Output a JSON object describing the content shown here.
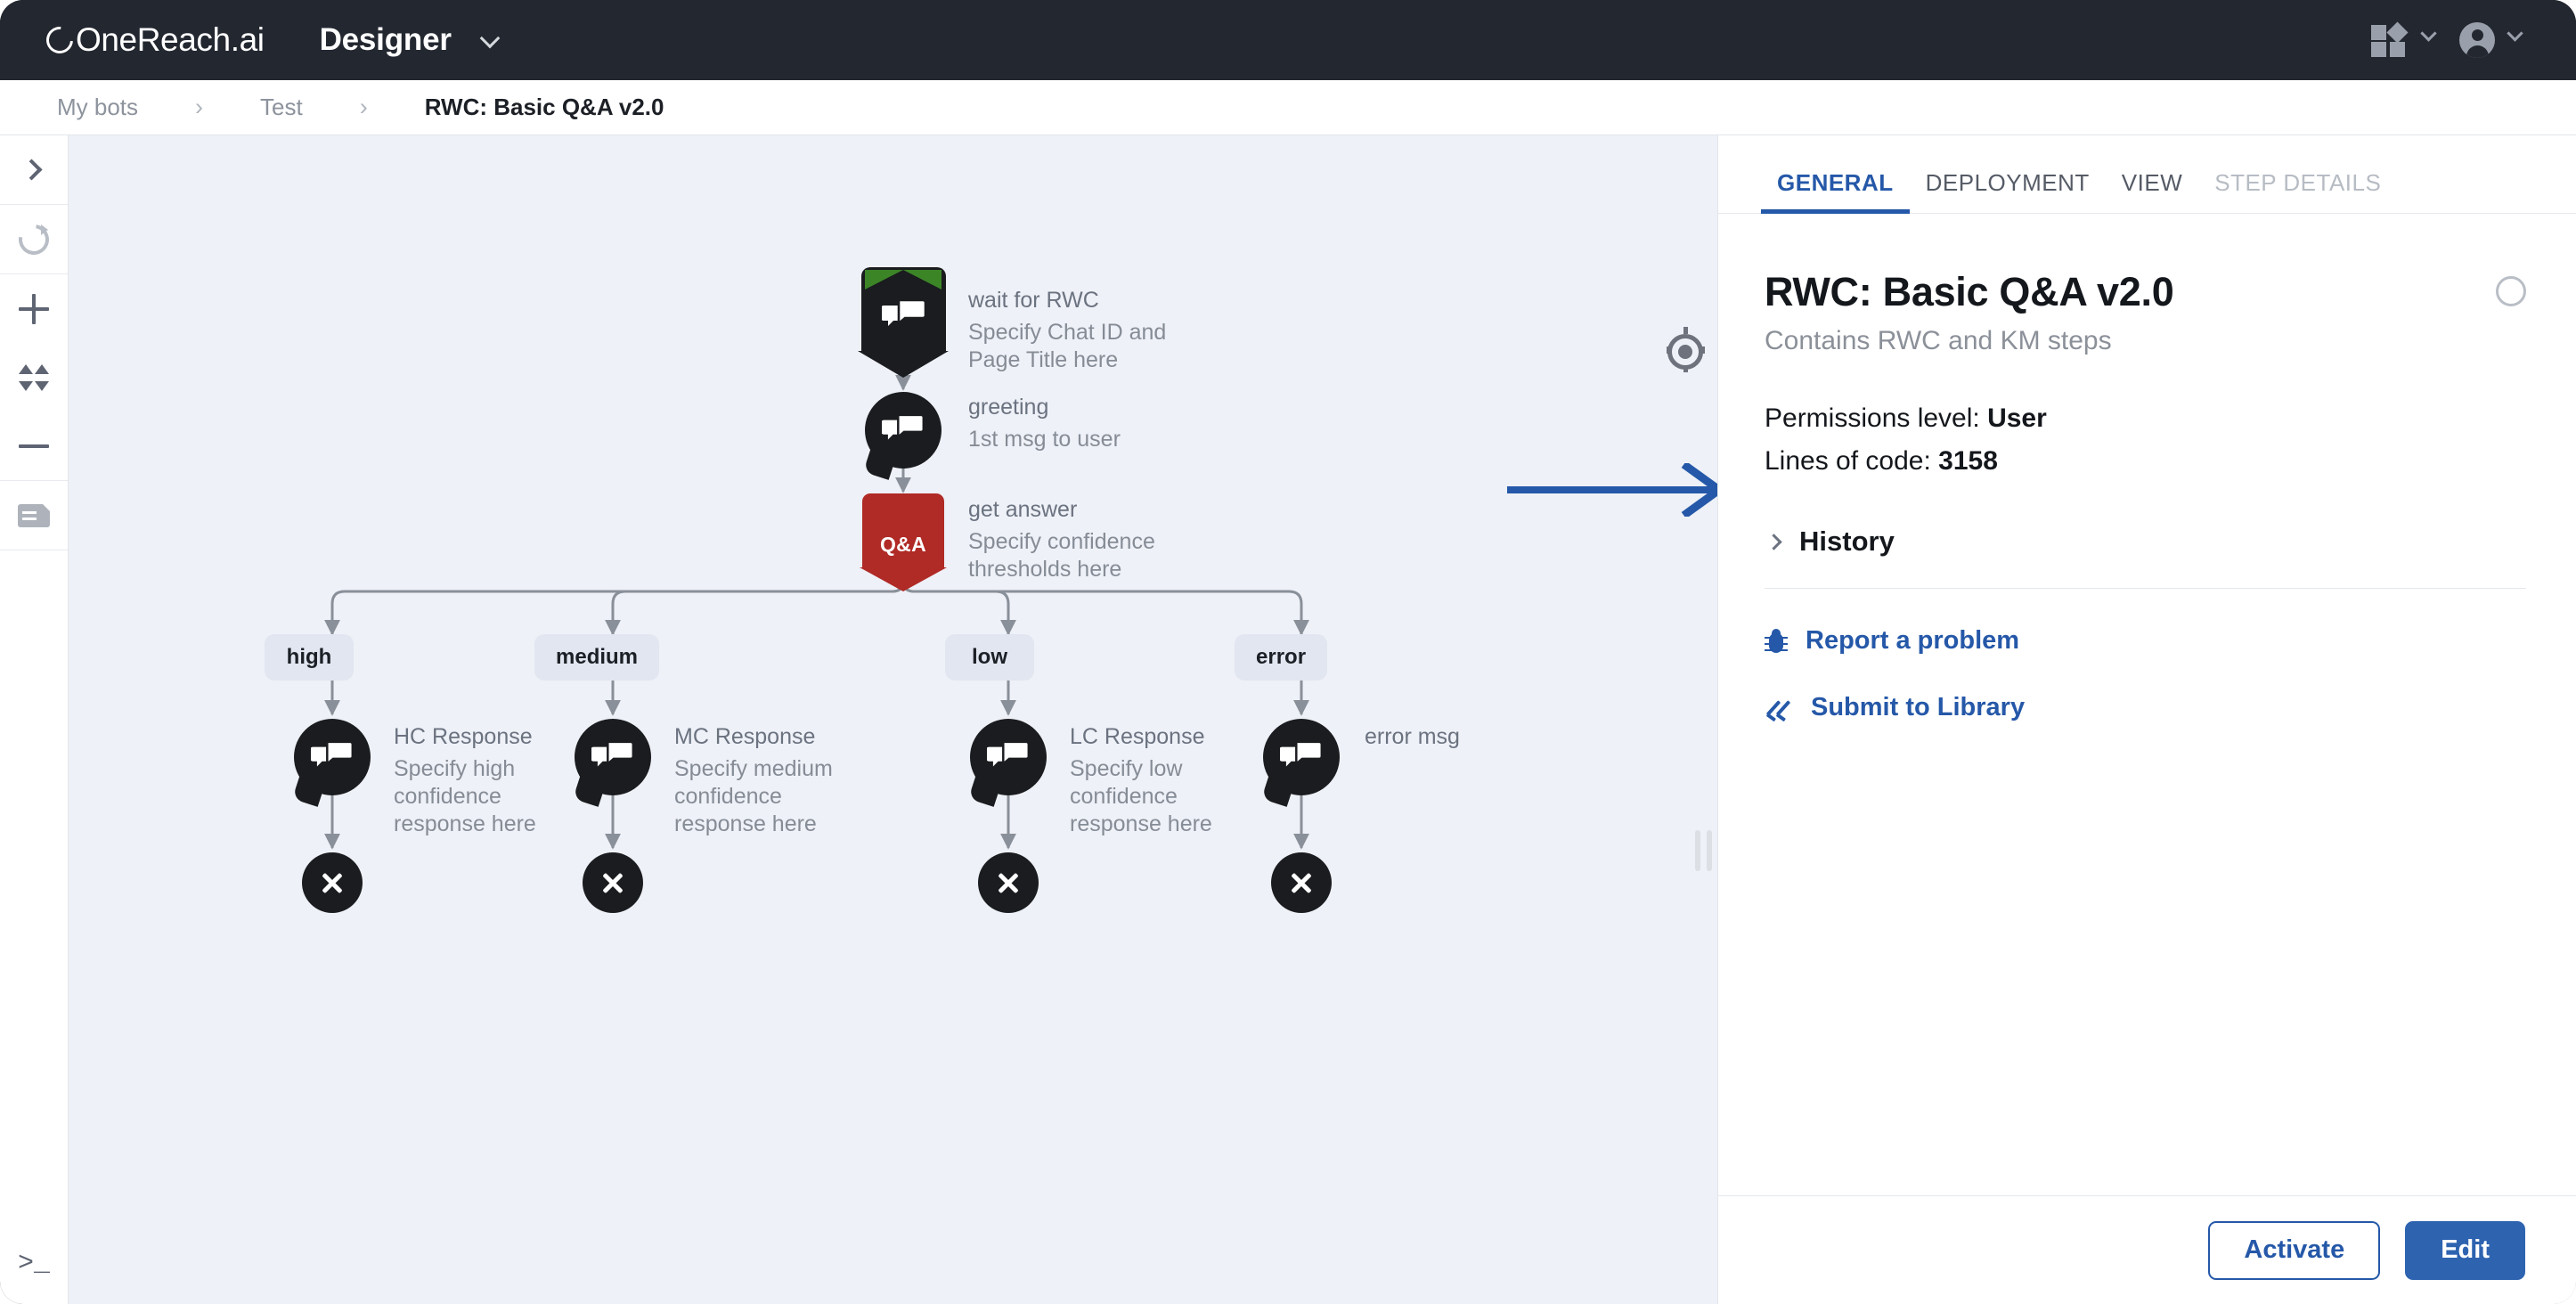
{
  "header": {
    "logo_text": "OneReach.ai",
    "app_title": "Designer",
    "title_chevron_icon": "chevron-down-icon",
    "apps_icon": "apps-grid-icon",
    "account_icon": "user-avatar-icon"
  },
  "breadcrumb": {
    "items": [
      {
        "label": "My bots"
      },
      {
        "label": "Test"
      },
      {
        "label": "RWC: Basic Q&A v2.0"
      }
    ],
    "separator": "›"
  },
  "rail": {
    "items": [
      {
        "name": "expand-panel",
        "icon": "chevron-right-icon"
      },
      {
        "name": "reload",
        "icon": "refresh-icon"
      },
      {
        "name": "zoom-in",
        "icon": "plus-icon"
      },
      {
        "name": "fit-to-screen",
        "icon": "expand-arrows-icon"
      },
      {
        "name": "zoom-out",
        "icon": "minus-icon"
      },
      {
        "name": "notes",
        "icon": "document-icon"
      }
    ],
    "terminal_label": ">_",
    "terminal_icon": "terminal-icon"
  },
  "canvas": {
    "recenter_icon": "target-crosshair-icon",
    "annotation_arrow_icon": "right-arrow-annotation",
    "resize_handle_icon": "drag-handle-icon",
    "flow": {
      "nodes": [
        {
          "id": "wait-for-rwc",
          "type": "start",
          "icon": "chat-bubbles-icon",
          "title": "wait for RWC",
          "subtitle": "Specify Chat ID and Page Title here"
        },
        {
          "id": "greeting",
          "type": "message",
          "icon": "chat-bubbles-icon",
          "title": "greeting",
          "subtitle": "1st msg to user"
        },
        {
          "id": "get-answer",
          "type": "qa",
          "badge": "Q&A",
          "title": "get answer",
          "subtitle": "Specify confidence thresholds here"
        },
        {
          "id": "hc-response",
          "type": "message",
          "icon": "chat-bubbles-icon",
          "title": "HC Response",
          "subtitle": "Specify high confidence response here"
        },
        {
          "id": "mc-response",
          "type": "message",
          "icon": "chat-bubbles-icon",
          "title": "MC Response",
          "subtitle": "Specify medium confidence response here"
        },
        {
          "id": "lc-response",
          "type": "message",
          "icon": "chat-bubbles-icon",
          "title": "LC Response",
          "subtitle": "Specify low confidence response here"
        },
        {
          "id": "error-msg",
          "type": "message",
          "icon": "chat-bubbles-icon",
          "title": "error msg",
          "subtitle": ""
        }
      ],
      "branches": [
        {
          "label": "high"
        },
        {
          "label": "medium"
        },
        {
          "label": "low"
        },
        {
          "label": "error"
        }
      ],
      "end_nodes": [
        {
          "icon": "close-x-icon"
        },
        {
          "icon": "close-x-icon"
        },
        {
          "icon": "close-x-icon"
        },
        {
          "icon": "close-x-icon"
        }
      ]
    }
  },
  "panel": {
    "tabs": [
      {
        "label": "GENERAL",
        "state": "active"
      },
      {
        "label": "DEPLOYMENT",
        "state": "default"
      },
      {
        "label": "VIEW",
        "state": "default"
      },
      {
        "label": "STEP DETAILS",
        "state": "disabled"
      }
    ],
    "title": "RWC: Basic Q&A v2.0",
    "subtitle": "Contains RWC and KM steps",
    "status_icon": "status-circle-icon",
    "permissions_label": "Permissions level: ",
    "permissions_value": "User",
    "lines_label": "Lines of code: ",
    "lines_value": "3158",
    "history_label": "History",
    "history_icon": "chevron-right-icon",
    "links": [
      {
        "label": "Report a problem",
        "icon": "bug-icon"
      },
      {
        "label": "Submit to Library",
        "icon": "double-check-icon"
      }
    ],
    "footer": {
      "activate_label": "Activate",
      "edit_label": "Edit"
    }
  },
  "colors": {
    "topbar_bg": "#232730",
    "canvas_bg": "#eef1f7",
    "accent_blue": "#2558a8",
    "primary_button": "#2e63b0",
    "node_dark": "#1a1c1f",
    "qa_red": "#b02a26",
    "start_green": "#3c8527",
    "pill_bg": "#e1e6f0"
  }
}
